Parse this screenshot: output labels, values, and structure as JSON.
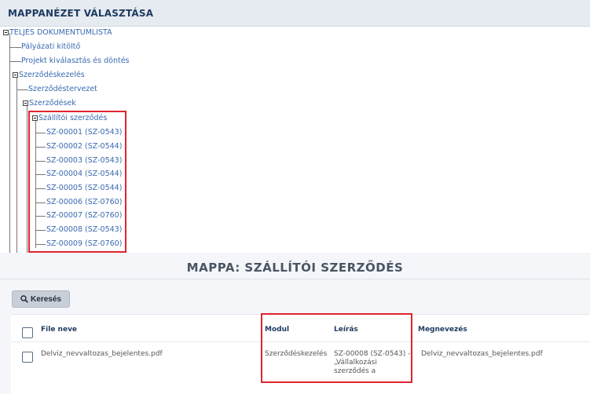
{
  "header": {
    "title": "MAPPANÉZET VÁLASZTÁSA"
  },
  "tree": {
    "root": "TELJES DOKUMENTUMLISTA",
    "items": [
      "Pályázati kitöltő",
      "Projekt kiválasztás és döntés",
      "Szerződéskezelés",
      "Szerződéstervezet",
      "Szerződések",
      "Szállítói szerződés",
      "SZ-00001 (SZ-0543)",
      "SZ-00002 (SZ-0544)",
      "SZ-00003 (SZ-0543)",
      "SZ-00004 (SZ-0544)",
      "SZ-00005 (SZ-0544)",
      "SZ-00006 (SZ-0760)",
      "SZ-00007 (SZ-0760)",
      "SZ-00008 (SZ-0543)",
      "SZ-00009 (SZ-0760)"
    ]
  },
  "folder": {
    "title": "MAPPA: SZÁLLÍTÓI SZERZŐDÉS"
  },
  "toolbar": {
    "search_label": "Keresés"
  },
  "table": {
    "headers": {
      "file": "File neve",
      "modul": "Modul",
      "leiras": "Leírás",
      "megnevezes": "Megnevezés"
    },
    "rows": [
      {
        "file": "Delviz_nevvaltozas_bejelentes.pdf",
        "modul": "Szerződéskezelés",
        "leiras": [
          "SZ-00008 (SZ-0543) -",
          "„Vállalkozási",
          "szerződés a"
        ],
        "megnevezes": "Delviz_nevvaltozas_bejelentes.pdf"
      }
    ]
  },
  "colors": {
    "accent": "#1e3a5f",
    "link": "#3a6ab0",
    "highlight": "#e0242e"
  }
}
